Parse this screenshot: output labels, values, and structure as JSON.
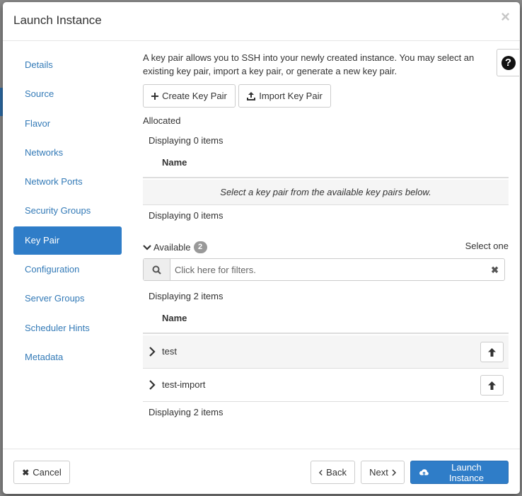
{
  "modal": {
    "title": "Launch Instance",
    "close_symbol": "×"
  },
  "sidebar": {
    "items": [
      {
        "label": "Details"
      },
      {
        "label": "Source"
      },
      {
        "label": "Flavor"
      },
      {
        "label": "Networks"
      },
      {
        "label": "Network Ports"
      },
      {
        "label": "Security Groups"
      },
      {
        "label": "Key Pair",
        "active": true
      },
      {
        "label": "Configuration"
      },
      {
        "label": "Server Groups"
      },
      {
        "label": "Scheduler Hints"
      },
      {
        "label": "Metadata"
      }
    ]
  },
  "help": {
    "symbol": "?"
  },
  "keypair": {
    "intro": "A key pair allows you to SSH into your newly created instance. You may select an existing key pair, import a key pair, or generate a new key pair.",
    "create_label": "Create Key Pair",
    "import_label": "Import Key Pair",
    "allocated_heading": "Allocated",
    "allocated_count_top": "Displaying 0 items",
    "allocated_col_name": "Name",
    "allocated_empty": "Select a key pair from the available key pairs below.",
    "allocated_count_bottom": "Displaying 0 items",
    "available_heading": "Available",
    "available_badge": "2",
    "select_one": "Select one",
    "filter_placeholder": "Click here for filters.",
    "available_count_top": "Displaying 2 items",
    "available_col_name": "Name",
    "available_rows": [
      {
        "name": "test"
      },
      {
        "name": "test-import"
      }
    ],
    "available_count_bottom": "Displaying 2 items"
  },
  "footer": {
    "cancel_label": "Cancel",
    "back_label": "Back",
    "next_label": "Next",
    "launch_label": "Launch Instance"
  },
  "colors": {
    "primary": "#2f7dc8",
    "link": "#337ab7",
    "badge": "#999999"
  }
}
